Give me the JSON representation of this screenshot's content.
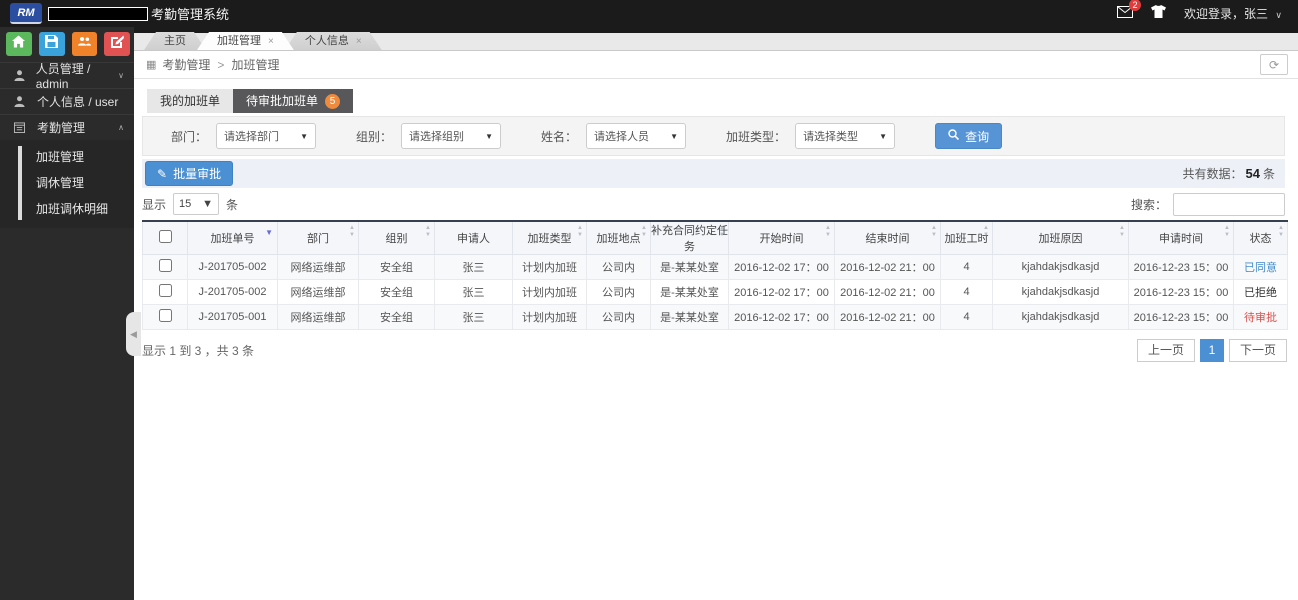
{
  "topbar": {
    "logo_text": "RM",
    "title": "考勤管理系统",
    "mail_badge": "2",
    "welcome": "欢迎登录，张三",
    "caret": "∨"
  },
  "sidebar": {
    "items": [
      {
        "label": "人员管理 / admin",
        "caret": "∨"
      },
      {
        "label": "个人信息 / user",
        "caret": ""
      },
      {
        "label": "考勤管理",
        "caret": "∧"
      }
    ],
    "subitems": [
      {
        "label": "加班管理"
      },
      {
        "label": "调休管理"
      },
      {
        "label": "加班调休明细"
      }
    ]
  },
  "window_tabs": [
    {
      "label": "主页",
      "close": ""
    },
    {
      "label": "加班管理",
      "close": "×",
      "active": true
    },
    {
      "label": "个人信息",
      "close": "×"
    }
  ],
  "breadcrumb": {
    "parent": "考勤管理",
    "sep": ">",
    "current": "加班管理"
  },
  "panel_tabs": [
    {
      "label": "我的加班单",
      "badge": ""
    },
    {
      "label": "待审批加班单",
      "badge": "5",
      "active": true
    }
  ],
  "filters": [
    {
      "label": "部门：",
      "value": "请选择部门"
    },
    {
      "label": "组别：",
      "value": "请选择组别"
    },
    {
      "label": "姓名：",
      "value": "请选择人员"
    },
    {
      "label": "加班类型：",
      "value": "请选择类型"
    }
  ],
  "query_button": "查询",
  "batch_button": "批量审批",
  "total": {
    "label": "共有数据：",
    "value": "54",
    "unit": "条"
  },
  "pagesize": {
    "prefix": "显示",
    "value": "15",
    "suffix": "条"
  },
  "search_label": "搜索：",
  "table": {
    "columns": [
      {
        "label": "",
        "sort": "none"
      },
      {
        "label": "加班单号",
        "sort": "desc"
      },
      {
        "label": "部门",
        "sort": "both"
      },
      {
        "label": "组别",
        "sort": "both"
      },
      {
        "label": "申请人",
        "sort": "none"
      },
      {
        "label": "加班类型",
        "sort": "both"
      },
      {
        "label": "加班地点",
        "sort": "both"
      },
      {
        "label": "补充合同约定任务",
        "sort": "both"
      },
      {
        "label": "开始时间",
        "sort": "both"
      },
      {
        "label": "结束时间",
        "sort": "both"
      },
      {
        "label": "加班工时",
        "sort": "both"
      },
      {
        "label": "加班原因",
        "sort": "both"
      },
      {
        "label": "申请时间",
        "sort": "both"
      },
      {
        "label": "状态",
        "sort": "both"
      }
    ],
    "rows": [
      {
        "cells": [
          "J-201705-002",
          "网络运维部",
          "安全组",
          "张三",
          "计划内加班",
          "公司内",
          "是-某某处室",
          "2016-12-02 17：00",
          "2016-12-02 21：00",
          "4",
          "kjahdakjsdkasjd",
          "2016-12-23 15：00"
        ],
        "status": {
          "label": "已同意",
          "type": "approved"
        }
      },
      {
        "cells": [
          "J-201705-002",
          "网络运维部",
          "安全组",
          "张三",
          "计划内加班",
          "公司内",
          "是-某某处室",
          "2016-12-02 17：00",
          "2016-12-02 21：00",
          "4",
          "kjahdakjsdkasjd",
          "2016-12-23 15：00"
        ],
        "status": {
          "label": "已拒绝",
          "type": "rejected"
        }
      },
      {
        "cells": [
          "J-201705-001",
          "网络运维部",
          "安全组",
          "张三",
          "计划内加班",
          "公司内",
          "是-某某处室",
          "2016-12-02 17：00",
          "2016-12-02 21：00",
          "4",
          "kjahdakjsdkasjd",
          "2016-12-23 15：00"
        ],
        "status": {
          "label": "待审批",
          "type": "pending"
        }
      }
    ]
  },
  "footer": {
    "info": "显示 1 到 3 ，共 3 条",
    "prev": "上一页",
    "page": "1",
    "next": "下一页"
  },
  "colors": {
    "accent_blue": "#4a90d2",
    "badge_orange": "#f08a3d",
    "approved": "#428bca",
    "rejected": "#333333",
    "pending": "#d9534f"
  }
}
